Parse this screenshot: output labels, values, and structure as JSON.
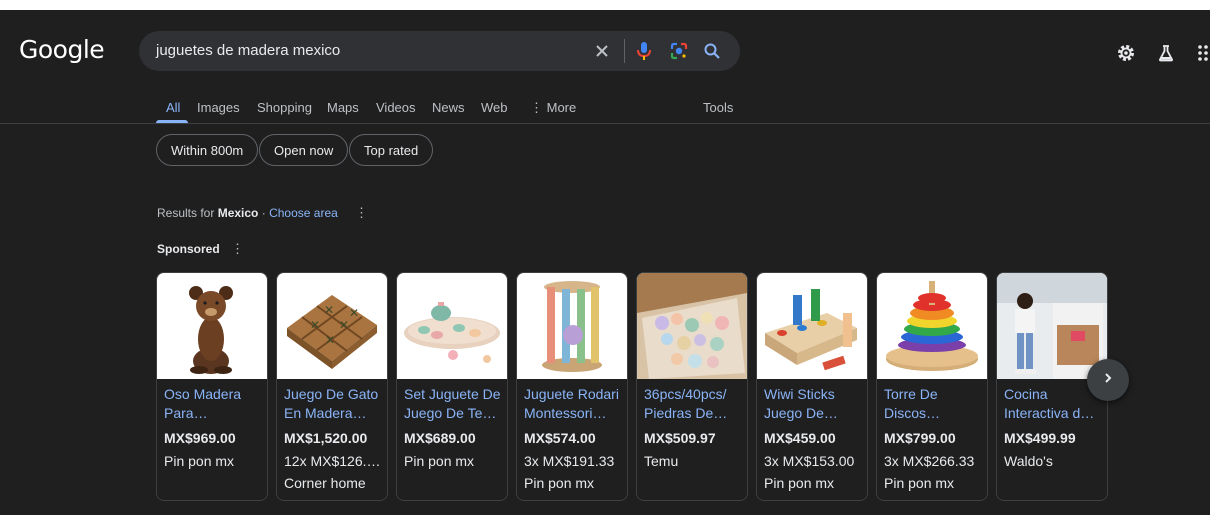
{
  "logo": "Google",
  "search": {
    "query": "juguetes de madera mexico"
  },
  "tabs": [
    {
      "label": "All"
    },
    {
      "label": "Images"
    },
    {
      "label": "Shopping"
    },
    {
      "label": "Maps"
    },
    {
      "label": "Videos"
    },
    {
      "label": "News"
    },
    {
      "label": "Web"
    },
    {
      "label": "⋮ More"
    },
    {
      "label": "Tools"
    }
  ],
  "chips": [
    {
      "label": "Within 800m"
    },
    {
      "label": "Open now"
    },
    {
      "label": "Top rated"
    }
  ],
  "location": {
    "prefix": "Results for",
    "place": "Mexico",
    "separator": "·",
    "choose_area": "Choose area"
  },
  "sponsored_label": "Sponsored",
  "products": [
    {
      "title1": "Oso Madera",
      "title2": "Para…",
      "price": "MX$969.00",
      "line1": "Pin pon mx",
      "line2": ""
    },
    {
      "title1": "Juego De Gato",
      "title2": "En Madera…",
      "price": "MX$1,520.00",
      "line1": "12x MX$126.…",
      "line2": "Corner home"
    },
    {
      "title1": "Set Juguete De",
      "title2": "Juego De Te…",
      "price": "MX$689.00",
      "line1": "Pin pon mx",
      "line2": ""
    },
    {
      "title1": "Juguete Rodari",
      "title2": "Montessori…",
      "price": "MX$574.00",
      "line1": "3x MX$191.33",
      "line2": "Pin pon mx"
    },
    {
      "title1": "36pcs/40pcs/",
      "title2": "Piedras De…",
      "price": "MX$509.97",
      "line1": "Temu",
      "line2": ""
    },
    {
      "title1": "Wiwi Sticks",
      "title2": "Juego De…",
      "price": "MX$459.00",
      "line1": "3x MX$153.00",
      "line2": "Pin pon mx"
    },
    {
      "title1": "Torre De",
      "title2": "Discos…",
      "price": "MX$799.00",
      "line1": "3x MX$266.33",
      "line2": "Pin pon mx"
    },
    {
      "title1": "Cocina",
      "title2": "Interactiva d…",
      "price": "MX$499.99",
      "line1": "Waldo's",
      "line2": ""
    }
  ],
  "colors": {
    "background": "#1f1f1f",
    "link": "#8ab4f8",
    "text": "#e8eaed",
    "muted": "#bdc1c6"
  },
  "icons": [
    "clear-icon",
    "mic-icon",
    "lens-icon",
    "search-icon",
    "settings-icon",
    "labs-icon",
    "apps-icon",
    "chevron-right-icon"
  ]
}
